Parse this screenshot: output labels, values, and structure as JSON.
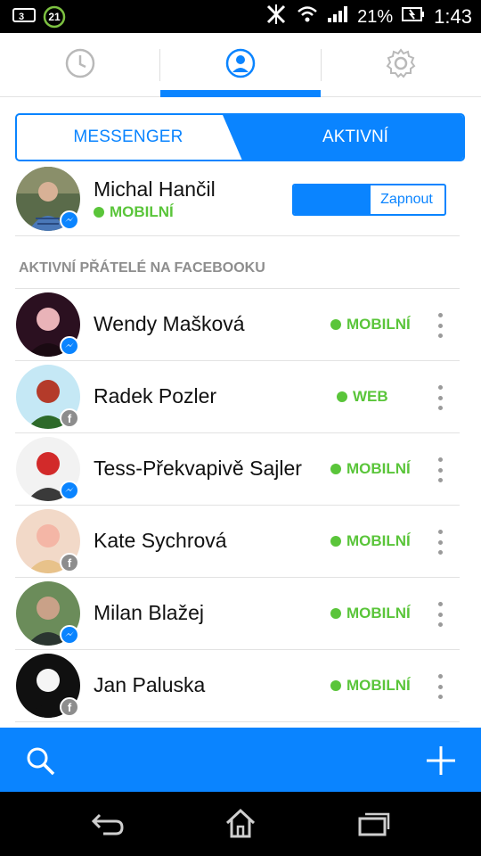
{
  "status_bar": {
    "left_icons": [
      "carrier-3-icon",
      "notification-21-icon"
    ],
    "notification_count": "21",
    "battery_percent": "21%",
    "time": "1:43"
  },
  "tabs": [
    {
      "icon": "clock-icon",
      "active": false
    },
    {
      "icon": "person-icon",
      "active": true
    },
    {
      "icon": "gear-icon",
      "active": false
    }
  ],
  "segment": {
    "left_label": "MESSENGER",
    "right_label": "AKTIVNÍ"
  },
  "me": {
    "name": "Michal Hančil",
    "status": "MOBILNÍ",
    "toggle_label": "Zapnout"
  },
  "section_title": "AKTIVNÍ PŘÁTELÉ NA FACEBOOKU",
  "friends": [
    {
      "name": "Wendy Mašková",
      "status": "MOBILNÍ",
      "badge": "messenger"
    },
    {
      "name": "Radek Pozler",
      "status": "WEB",
      "badge": "facebook"
    },
    {
      "name": "Tess-Překvapivě Sajler",
      "status": "MOBILNÍ",
      "badge": "messenger"
    },
    {
      "name": "Kate Sychrová",
      "status": "MOBILNÍ",
      "badge": "facebook"
    },
    {
      "name": "Milan Blažej",
      "status": "MOBILNÍ",
      "badge": "messenger"
    },
    {
      "name": "Jan Paluska",
      "status": "MOBILNÍ",
      "badge": "facebook"
    }
  ],
  "bottom_bar": {
    "left_icon": "search-icon",
    "right_icon": "plus-icon"
  },
  "colors": {
    "accent": "#0a84ff",
    "online_green": "#5ac53a",
    "section_gray": "#8e8e8e"
  }
}
